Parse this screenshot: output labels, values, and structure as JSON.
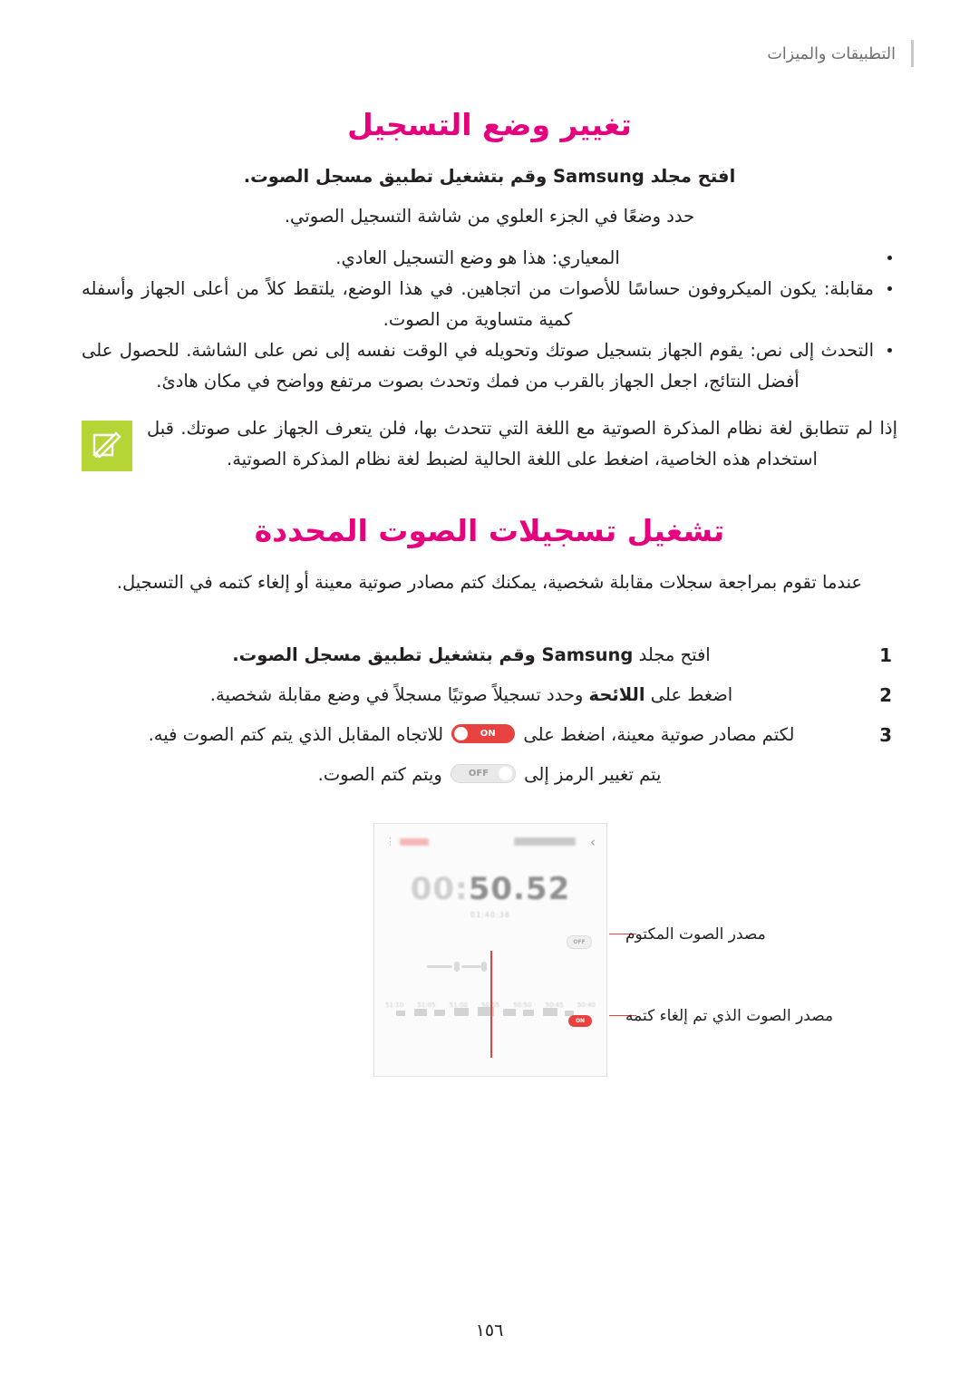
{
  "header": {
    "title": "التطبيقات والميزات"
  },
  "sections": {
    "heading1": "تغيير وضع التسجيل",
    "intro1": "افتح مجلد Samsung وقم بتشغيل تطبيق مسجل الصوت.",
    "intro2": "حدد وضعًا في الجزء العلوي من شاشة التسجيل الصوتي.",
    "bullets": [
      "المعياري: هذا هو وضع التسجيل العادي.",
      "مقابلة: يكون الميكروفون حساسًا للأصوات من اتجاهين. في هذا الوضع، يلتقط كلاً من أعلى الجهاز وأسفله كمية متساوية من الصوت.",
      "التحدث إلى نص: يقوم الجهاز بتسجيل صوتك وتحويله في الوقت نفسه إلى نص على الشاشة. للحصول على أفضل النتائج، اجعل الجهاز بالقرب من فمك وتحدث بصوت مرتفع وواضح في مكان هادئ."
    ],
    "note": "إذا لم تتطابق لغة نظام المذكرة الصوتية مع اللغة التي تتحدث بها، فلن يتعرف الجهاز على صوتك. قبل استخدام هذه الخاصية، اضغط على اللغة الحالية لضبط لغة نظام المذكرة الصوتية.",
    "heading2": "تشغيل تسجيلات الصوت المحددة",
    "intro3": "عندما تقوم بمراجعة سجلات مقابلة شخصية، يمكنك كتم مصادر صوتية معينة أو إلغاء كتمه في التسجيل."
  },
  "steps": [
    {
      "num": "1",
      "text_before": "افتح مجلد ",
      "brand": "Samsung",
      "text_after": " وقم بتشغيل تطبيق مسجل الصوت."
    },
    {
      "num": "2",
      "text_before": "اضغط على ",
      "bold": "اللائحة",
      "text_after": " وحدد تسجيلاً صوتيًا مسجلاً في وضع مقابلة شخصية."
    },
    {
      "num": "3",
      "text_before": "لكتم مصادر صوتية معينة، اضغط على ",
      "chip_on": "ON",
      "text_after": " للاتجاه المقابل الذي يتم كتم الصوت فيه."
    }
  ],
  "step3_extra": {
    "text_before": "يتم تغيير الرمز إلى ",
    "chip_off": "OFF",
    "text_after": " ويتم كتم الصوت."
  },
  "illustration": {
    "timer_prefix": "00",
    "timer_main": "50.52",
    "timer_sub": "01:40:36",
    "scale_labels": [
      "50:40",
      "50:45",
      "50:50",
      "50:55",
      "51:00",
      "51:05",
      "51:10"
    ],
    "badge_muted": "OFF",
    "badge_active": "ON",
    "callout_muted": "مصدر الصوت المكتوم",
    "callout_unmuted": "مصدر الصوت الذي تم إلغاء كتمه"
  },
  "footer": {
    "page_number": "١٥٦"
  },
  "colors": {
    "accent": "#e6007e",
    "note_badge": "#b5d435",
    "red": "#e8413f"
  }
}
